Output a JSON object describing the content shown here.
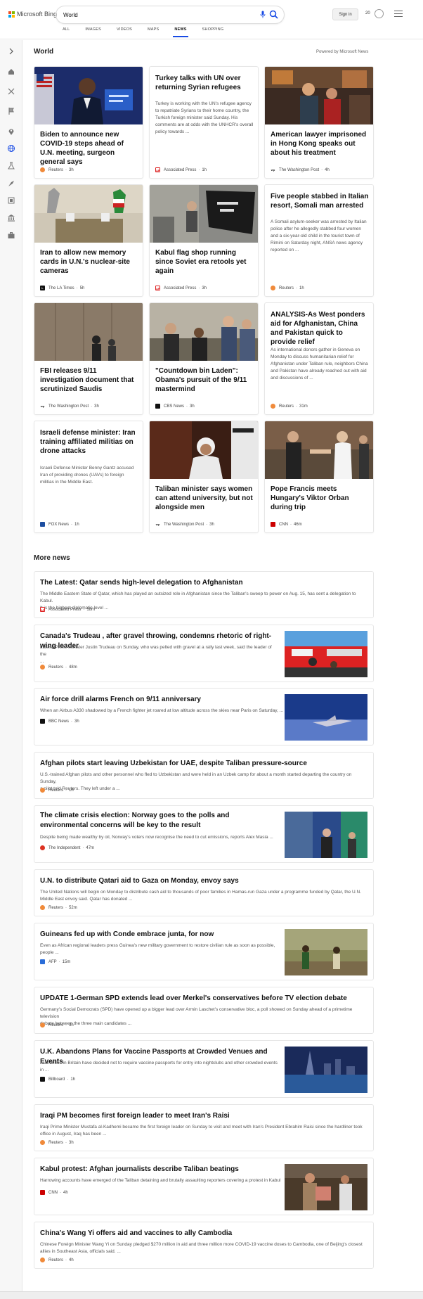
{
  "header": {
    "logo_text": "Microsoft Bing",
    "search_value": "World",
    "signin_label": "Sign in",
    "rewards_count": "20"
  },
  "tabs": [
    "ALL",
    "IMAGES",
    "VIDEOS",
    "MAPS",
    "NEWS",
    "SHOPPING"
  ],
  "world": {
    "title": "World",
    "powered": "Powered by Microsoft News"
  },
  "cards": [
    {
      "title": "Biden to announce new COVID-19 steps ahead of U.N. meeting, surgeon general says",
      "source": "Reuters",
      "time": "3h",
      "src_color": "#f08a3a"
    },
    {
      "title": "Turkey talks with UN over returning Syrian refugees",
      "snippet": "Turkey is working with the UN's refugee agency to repatriate Syrians to their home country, the Turkish foreign minister said Sunday. His comments are at odds with the UNHCR's overall policy towards ...",
      "source": "Associated Press",
      "time": "1h",
      "src_color": "#d22"
    },
    {
      "title": "American lawyer imprisoned in Hong Kong speaks out about his treatment",
      "source": "The Washington Post",
      "time": "4h",
      "src_color": "#222"
    },
    {
      "title": "Iran to allow new memory cards in U.N.'s nuclear-site cameras",
      "source": "The LA Times",
      "time": "5h",
      "src_color": "#111"
    },
    {
      "title": "Kabul flag shop running since Soviet era retools yet again",
      "source": "Associated Press",
      "time": "3h",
      "src_color": "#d22"
    },
    {
      "title": "Five people stabbed in Italian resort, Somali man arrested",
      "snippet": "A Somali asylum-seeker was arrested by Italian police after he allegedly stabbed four women and a six-year-old child in the tourist town of Rimini on Saturday night, ANSA news agency reported on ...",
      "source": "Reuters",
      "time": "1h",
      "src_color": "#f08a3a"
    },
    {
      "title": "FBI releases 9/11 investigation document that scrutinized Saudis",
      "source": "The Washington Post",
      "time": "3h",
      "src_color": "#222"
    },
    {
      "title": "\"Countdown bin Laden\": Obama's pursuit of the 9/11 mastermind",
      "source": "CBS News",
      "time": "3h",
      "src_color": "#111"
    },
    {
      "title": "ANALYSIS-As West ponders aid for Afghanistan, China and Pakistan quick to provide relief",
      "snippet": "As international donors gather in Geneva on Monday to discuss humanitarian relief for Afghanistan under Taliban rule, neighbors China and Pakistan have already reached out with aid and discussions of ...",
      "source": "Reuters",
      "time": "31m",
      "src_color": "#f08a3a"
    },
    {
      "title": "Israeli defense minister: Iran training affiliated militias on drone attacks",
      "snippet": "Israeli Defense Minister Benny Gantz accused Iran of providing drones (UAVs) to foreign militias in the Middle East.",
      "source": "FOX News",
      "time": "1h",
      "src_color": "#1d4ea0"
    },
    {
      "title": "Taliban minister says women can attend university, but not alongside men",
      "source": "The Washington Post",
      "time": "3h",
      "src_color": "#222"
    },
    {
      "title": "Pope Francis meets Hungary's Viktor Orban during trip",
      "source": "CNN",
      "time": "46m",
      "src_color": "#cc0000"
    }
  ],
  "more_news": {
    "title": "More news",
    "items": [
      {
        "title": "The Latest: Qatar sends high-level delegation to Afghanistan",
        "snippet1": "The Middle Eastern State of Qatar, which has played an outsized role in Afghanistan since the Taliban's sweep to power on Aug. 15, has sent a delegation to Kabul.",
        "snippet2": "It is the highest diplomatic level ...",
        "source": "Associated Press",
        "time": "18m",
        "src_color": "#d22"
      },
      {
        "title": "Canada's Trudeau , after gravel throwing, condemns rhetoric of right-wing leader",
        "snippet1": "Liberal Prime Minister Justin Trudeau on Sunday, who was pelted with gravel at a rally last week, said the leader of the",
        "snippet2": "...",
        "source": "Reuters",
        "time": "48m",
        "src_color": "#f08a3a"
      },
      {
        "title": "Air force drill alarms French on 9/11 anniversary",
        "snippet1": "When an Airbus A330 shadowed by a French fighter jet roared at low altitude across the skies near Paris on Saturday, ...",
        "snippet2": "",
        "source": "BBC News",
        "time": "3h",
        "src_color": "#111"
      },
      {
        "title": "Afghan pilots start leaving Uzbekistan for UAE, despite Taliban pressure-source",
        "snippet1": "U.S.-trained Afghan pilots and other personnel who fled to Uzbekistan and were held in an Uzbek camp for about a month started departing the country on Sunday,",
        "snippet2": "a pilot told Reuters. They left under a ...",
        "source": "Reuters",
        "time": "1h",
        "src_color": "#f08a3a"
      },
      {
        "title": "The climate crisis election: Norway goes to the polls and environmental concerns will be key to the result",
        "snippet1": "Despite being made wealthy by oil, Norway's voters now recognise the need to cut emissions, reports Alex Masia ...",
        "snippet2": "",
        "source": "The Independent",
        "time": "47m",
        "src_color": "#d32"
      },
      {
        "title": "U.N. to distribute Qatari aid to Gaza on Monday, envoy says",
        "snippet1": "The United Nations will begin on Monday to distribute cash aid to thousands of poor families in Hamas-run Gaza under a programme funded by Qatar, the U.N.",
        "snippet2": "Middle East envoy said. Qatar has donated ...",
        "source": "Reuters",
        "time": "52m",
        "src_color": "#f08a3a"
      },
      {
        "title": "Guineans fed up with Conde embrace junta, for now",
        "snippet1": "Even as African regional leaders press Guinea's new military government to restore civilian rule as soon as possible,",
        "snippet2": "people ...",
        "source": "AFP",
        "time": "15m",
        "src_color": "#2a6dd8"
      },
      {
        "title": "UPDATE 1-German SPD extends lead over Merkel's conservatives before TV election debate",
        "snippet1": "Germany's Social Democrats (SPD) have opened up a bigger lead over Armin Laschet's conservative bloc, a poll showed on Sunday ahead of a primetime television",
        "snippet2": "debate between the three main candidates ...",
        "source": "Reuters",
        "time": "3h",
        "src_color": "#f08a3a"
      },
      {
        "title": "U.K. Abandons Plans for Vaccine Passports at Crowded Venues and Events",
        "snippet1": "Authorities in Britain have decided not to require vaccine passports for entry into nightclubs and other crowded events",
        "snippet2": "in ...",
        "source": "Billboard",
        "time": "1h",
        "src_color": "#111"
      },
      {
        "title": "Iraqi PM becomes first foreign leader to meet Iran's Raisi",
        "snippet1": "Iraqi Prime Minister Mustafa al-Kadhemi became the first foreign leader on Sunday to visit and meet with Iran's President Ebrahim Raisi since the hardliner took",
        "snippet2": "office in August, Iraq has been ...",
        "source": "Reuters",
        "time": "3h",
        "src_color": "#f08a3a"
      },
      {
        "title": "Kabul protest: Afghan journalists describe Taliban beatings",
        "snippet1": "Harrowing accounts have emerged of the Taliban detaining and brutally assaulting reporters covering a protest in Kabul",
        "snippet2": "",
        "source": "CNN",
        "time": "4h",
        "src_color": "#cc0000"
      },
      {
        "title": "China's Wang Yi offers aid and vaccines to ally Cambodia",
        "snippet1": "Chinese Foreign Minister Wang Yi on Sunday pledged $270 million in aid and three million more COVID-19 vaccine doses to Cambodia, one of Beijing's closest",
        "snippet2": "allies in Southeast Asia, officials said. ...",
        "source": "Reuters",
        "time": "4h",
        "src_color": "#f08a3a"
      }
    ]
  }
}
